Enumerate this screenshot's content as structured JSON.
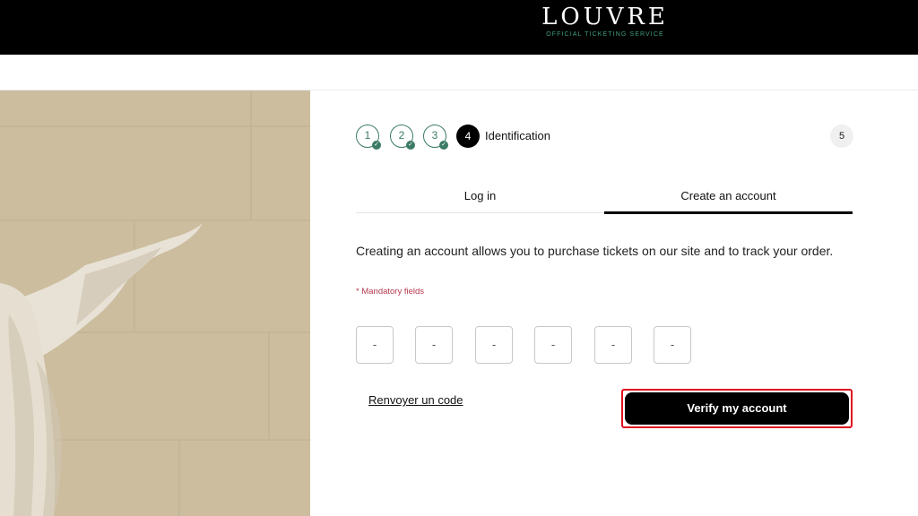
{
  "header": {
    "logo_title": "LOUVRE",
    "logo_subtitle": "OFFICIAL TICKETING SERVICE"
  },
  "steps": {
    "items": [
      {
        "number": "1",
        "state": "done"
      },
      {
        "number": "2",
        "state": "done"
      },
      {
        "number": "3",
        "state": "done"
      }
    ],
    "active_number": "4",
    "active_label": "Identification",
    "last_number": "5"
  },
  "tabs": {
    "login": "Log in",
    "create": "Create an account",
    "active": "create"
  },
  "form": {
    "intro": "Creating an account allows you to purchase tickets on our site and to track your order.",
    "mandatory": "* Mandatory fields",
    "code_placeholders": [
      "-",
      "-",
      "-",
      "-",
      "-",
      "-"
    ],
    "resend_label": "Renvoyer un code",
    "verify_label": "Verify my account"
  },
  "colors": {
    "accent_green": "#3c7b66",
    "highlight_red": "#e0101f",
    "mandatory_red": "#b5384e"
  },
  "icons": {
    "step_done": "check-icon"
  }
}
